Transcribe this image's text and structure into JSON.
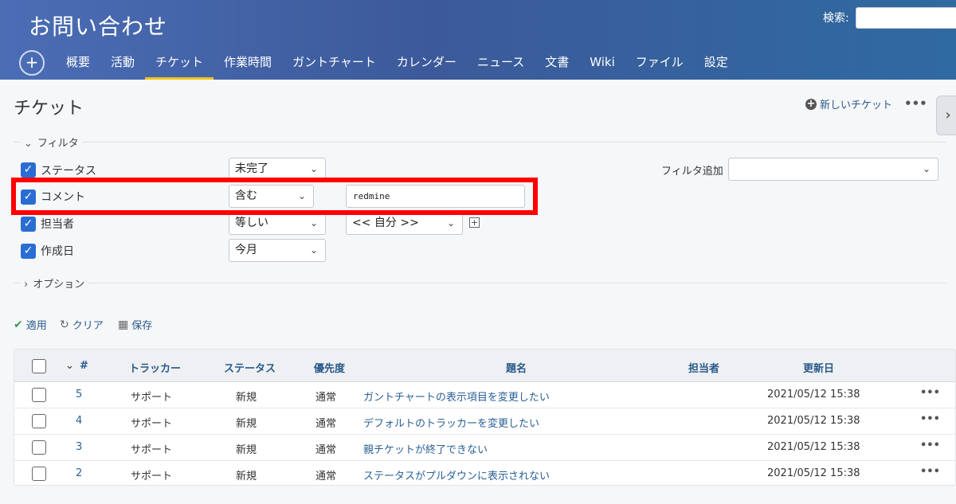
{
  "header": {
    "project_title": "お問い合わせ",
    "search_label": "検索:",
    "menu": [
      "概要",
      "活動",
      "チケット",
      "作業時間",
      "ガントチャート",
      "カレンダー",
      "ニュース",
      "文書",
      "Wiki",
      "ファイル",
      "設定"
    ],
    "selected_menu": "チケット"
  },
  "page": {
    "title": "チケット",
    "new_issue": "新しいチケット",
    "more": "•••"
  },
  "filters": {
    "legend": "フィルタ",
    "add_label": "フィルタ追加",
    "rows": [
      {
        "label": "ステータス",
        "operator": "未完了",
        "checked": true
      },
      {
        "label": "コメント",
        "operator": "含む",
        "value": "redmine",
        "checked": true
      },
      {
        "label": "担当者",
        "operator": "等しい",
        "value": "<< 自分 >>",
        "checked": true
      },
      {
        "label": "作成日",
        "operator": "今月",
        "checked": true
      }
    ]
  },
  "options": {
    "legend": "オプション"
  },
  "actions": {
    "apply": "適用",
    "clear": "クリア",
    "save": "保存"
  },
  "table": {
    "headers": {
      "id": "#",
      "tracker": "トラッカー",
      "status": "ステータス",
      "priority": "優先度",
      "subject": "題名",
      "assignee": "担当者",
      "updated": "更新日"
    },
    "rows": [
      {
        "id": "5",
        "tracker": "サポート",
        "status": "新規",
        "priority": "通常",
        "subject": "ガントチャートの表示項目を変更したい",
        "updated": "2021/05/12 15:38"
      },
      {
        "id": "4",
        "tracker": "サポート",
        "status": "新規",
        "priority": "通常",
        "subject": "デフォルトのトラッカーを変更したい",
        "updated": "2021/05/12 15:38"
      },
      {
        "id": "3",
        "tracker": "サポート",
        "status": "新規",
        "priority": "通常",
        "subject": "親チケットが終了できない",
        "updated": "2021/05/12 15:38"
      },
      {
        "id": "2",
        "tracker": "サポート",
        "status": "新規",
        "priority": "通常",
        "subject": "ステータスがプルダウンに表示されない",
        "updated": "2021/05/12 15:38"
      }
    ]
  },
  "colors": {
    "accent": "#f0c419",
    "highlight": "#ff0000",
    "link": "#2a5a8a",
    "checkbox": "#2a6dd2"
  }
}
